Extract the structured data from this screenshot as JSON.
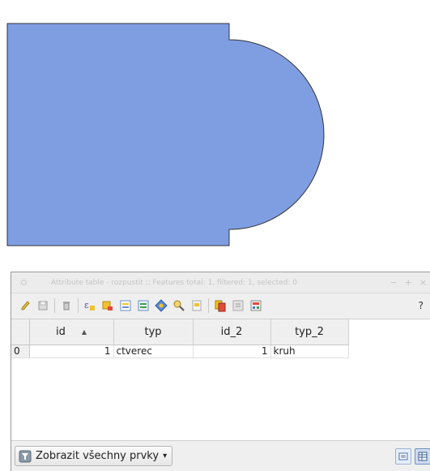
{
  "map": {
    "fill_color": "#7f9ee2",
    "stroke_color": "#333333",
    "features": [
      {
        "name": "ctverec",
        "shape": "square"
      },
      {
        "name": "kruh",
        "shape": "circle"
      }
    ]
  },
  "window": {
    "title": "Attribute table - rozpustit :: Features total: 1, filtered: 1, selected: 0",
    "controls": [
      "−",
      "+",
      "×"
    ]
  },
  "toolbar": {
    "icons": [
      "pencil-icon",
      "save-icon",
      "delete-icon",
      "expression-select-icon",
      "select-all-icon",
      "invert-selection-icon",
      "deselect-icon",
      "move-to-top-icon",
      "pan-to-selected-icon",
      "zoom-to-selected-icon",
      "copy-icon",
      "paste-icon",
      "field-calculator-icon"
    ],
    "help_label": "?"
  },
  "table": {
    "columns": [
      {
        "label": "id",
        "sort": "▲"
      },
      {
        "label": "typ"
      },
      {
        "label": "id_2"
      },
      {
        "label": "typ_2"
      }
    ],
    "rows": [
      {
        "row_label": "0",
        "id": "1",
        "typ": "ctverec",
        "id_2": "1",
        "typ_2": "kruh"
      }
    ]
  },
  "bottom": {
    "filter_label": "Zobrazit všechny prvky",
    "dropdown_arrow": "▾"
  }
}
